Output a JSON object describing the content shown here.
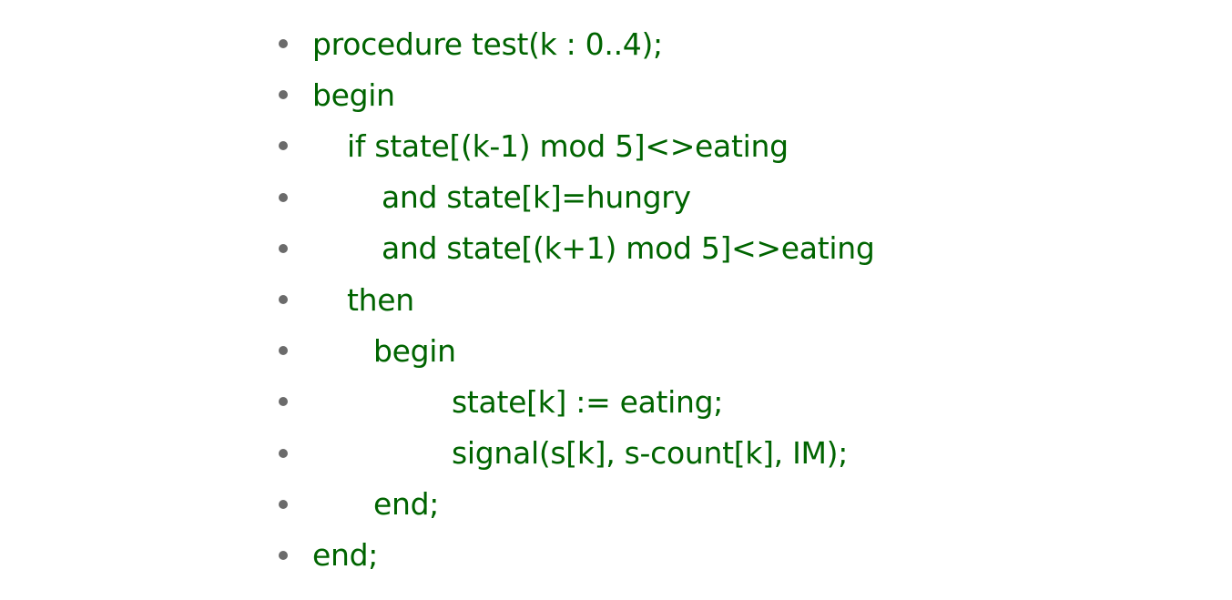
{
  "document": {
    "lines": [
      {
        "text": "procedure test(k : 0..4);",
        "indent": 0
      },
      {
        "text": "begin",
        "indent": 0
      },
      {
        "text": "if state[(k-1) mod 5]<>eating",
        "indent": 1
      },
      {
        "text": "and state[k]=hungry",
        "indent": 2
      },
      {
        "text": "and state[(k+1) mod 5]<>eating",
        "indent": 2
      },
      {
        "text": "then",
        "indent": 1
      },
      {
        "text": "begin",
        "indent": 1.7
      },
      {
        "text": "state[k] := eating;",
        "indent": 4
      },
      {
        "text": "signal(s[k], s-count[k], IM);",
        "indent": 4
      },
      {
        "text": "end;",
        "indent": 1.7
      },
      {
        "text": "end;",
        "indent": 0
      }
    ]
  },
  "colors": {
    "code_text": "#006400",
    "bullet": "#6b6b6b",
    "background": "#ffffff"
  }
}
